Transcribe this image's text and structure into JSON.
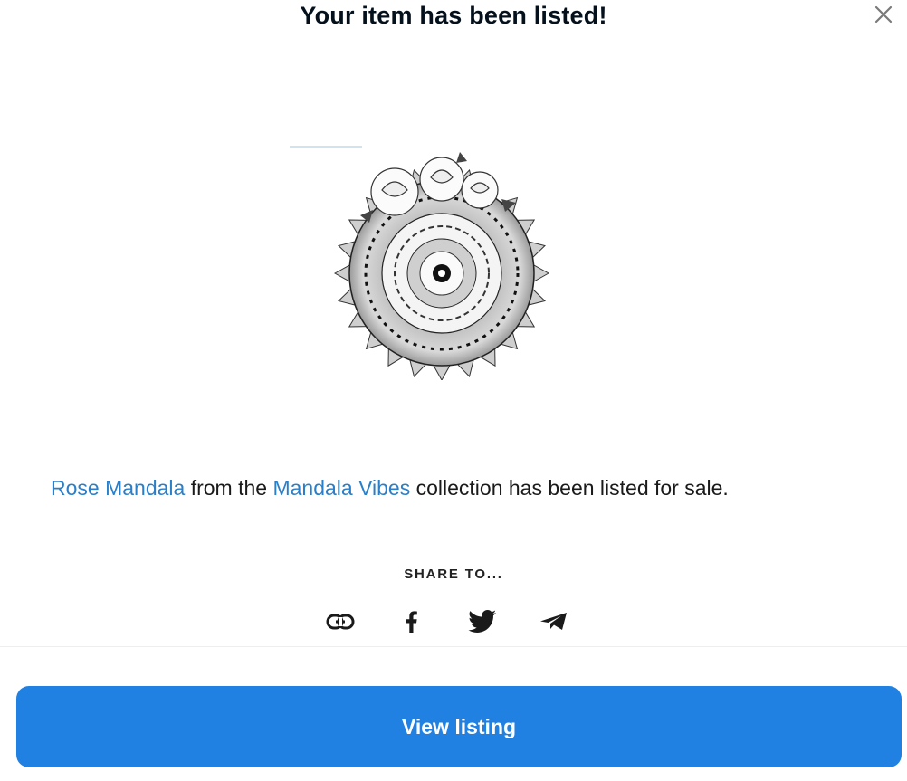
{
  "modal": {
    "title": "Your item has been listed!",
    "close_icon": "close-icon"
  },
  "item": {
    "artwork_icon": "rose-mandala-artwork",
    "name": "Rose Mandala",
    "text_from": "from the",
    "collection": "Mandala Vibes",
    "text_suffix": "collection has been listed for sale."
  },
  "share": {
    "label": "SHARE TO...",
    "icons": [
      "link-icon",
      "facebook-icon",
      "twitter-icon",
      "telegram-icon"
    ]
  },
  "actions": {
    "view_listing": "View listing"
  },
  "colors": {
    "link": "#2a7fc9",
    "primary_button": "#2081e2",
    "title": "#04111d"
  }
}
